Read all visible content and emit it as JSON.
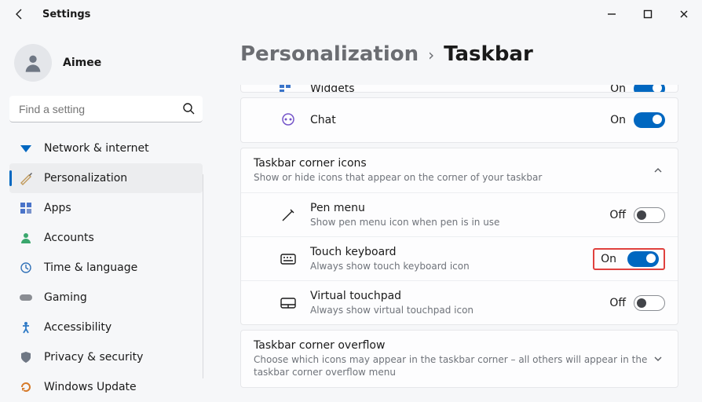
{
  "app_title": "Settings",
  "user": {
    "name": "Aimee"
  },
  "search": {
    "placeholder": "Find a setting"
  },
  "sidebar": {
    "items": [
      {
        "label": "Network & internet",
        "icon": "wifi-icon"
      },
      {
        "label": "Personalization",
        "icon": "brush-icon",
        "selected": true
      },
      {
        "label": "Apps",
        "icon": "apps-icon"
      },
      {
        "label": "Accounts",
        "icon": "person-icon"
      },
      {
        "label": "Time & language",
        "icon": "globe-clock-icon"
      },
      {
        "label": "Gaming",
        "icon": "gamepad-icon"
      },
      {
        "label": "Accessibility",
        "icon": "accessibility-icon"
      },
      {
        "label": "Privacy & security",
        "icon": "shield-icon"
      },
      {
        "label": "Windows Update",
        "icon": "update-icon"
      }
    ]
  },
  "breadcrumb": {
    "parent": "Personalization",
    "current": "Taskbar"
  },
  "rows": {
    "widgets": {
      "label": "Widgets",
      "state": "On",
      "on": true
    },
    "chat": {
      "label": "Chat",
      "state": "On",
      "on": true
    },
    "corner_icons": {
      "title": "Taskbar corner icons",
      "desc": "Show or hide icons that appear on the corner of your taskbar"
    },
    "pen": {
      "label": "Pen menu",
      "desc": "Show pen menu icon when pen is in use",
      "state": "Off",
      "on": false
    },
    "touch": {
      "label": "Touch keyboard",
      "desc": "Always show touch keyboard icon",
      "state": "On",
      "on": true
    },
    "vtp": {
      "label": "Virtual touchpad",
      "desc": "Always show virtual touchpad icon",
      "state": "Off",
      "on": false
    },
    "overflow": {
      "title": "Taskbar corner overflow",
      "desc": "Choose which icons may appear in the taskbar corner – all others will appear in the taskbar corner overflow menu"
    }
  }
}
